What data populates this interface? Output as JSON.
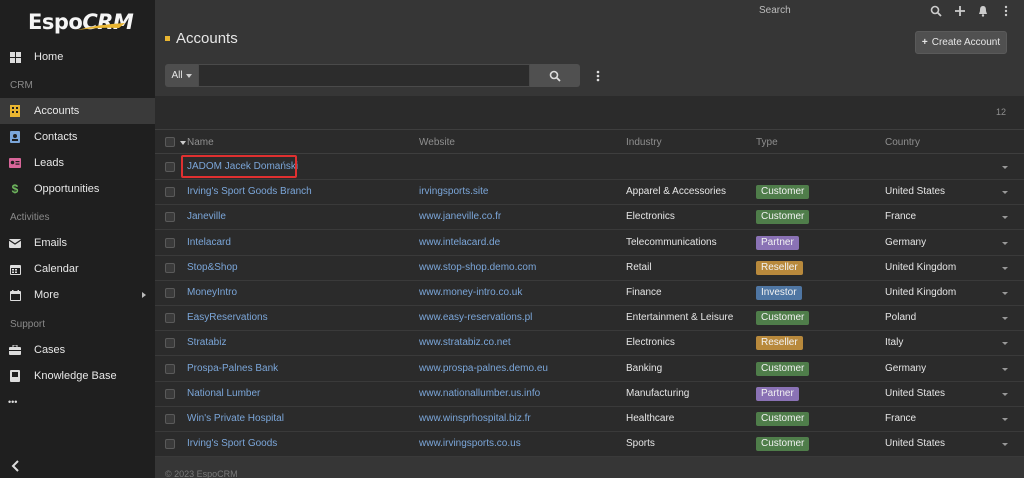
{
  "app": {
    "logo_text": "Espo",
    "logo_text_2": "CRM"
  },
  "sidebar": {
    "items": [
      {
        "label": "Home",
        "icon": "home-icon"
      },
      {
        "label": "Accounts",
        "icon": "building-icon",
        "active": true
      },
      {
        "label": "Contacts",
        "icon": "contact-card-icon"
      },
      {
        "label": "Leads",
        "icon": "id-card-icon"
      },
      {
        "label": "Opportunities",
        "icon": "dollar-icon"
      },
      {
        "label": "Emails",
        "icon": "envelope-icon"
      },
      {
        "label": "Calendar",
        "icon": "calendar-icon"
      },
      {
        "label": "More",
        "icon": "calendar-alt-icon"
      },
      {
        "label": "Cases",
        "icon": "briefcase-icon"
      },
      {
        "label": "Knowledge Base",
        "icon": "book-icon"
      }
    ],
    "sections": {
      "crm": "CRM",
      "activities": "Activities",
      "support": "Support"
    },
    "more_dots": "•••"
  },
  "topbar": {
    "search_placeholder": "Search"
  },
  "header": {
    "title": "Accounts",
    "create_label": "Create Account"
  },
  "search": {
    "filter_label": "All",
    "value": ""
  },
  "list": {
    "count": "12",
    "columns": {
      "name": "Name",
      "website": "Website",
      "industry": "Industry",
      "type": "Type",
      "country": "Country"
    },
    "rows": [
      {
        "name": "JADOM Jacek Domański",
        "website": "",
        "industry": "",
        "type": "",
        "country": ""
      },
      {
        "name": "Irving's Sport Goods Branch",
        "website": "irvingsports.site",
        "industry": "Apparel & Accessories",
        "type": "Customer",
        "country": "United States"
      },
      {
        "name": "Janeville",
        "website": "www.janeville.co.fr",
        "industry": "Electronics",
        "type": "Customer",
        "country": "France"
      },
      {
        "name": "Intelacard",
        "website": "www.intelacard.de",
        "industry": "Telecommunications",
        "type": "Partner",
        "country": "Germany"
      },
      {
        "name": "Stop&Shop",
        "website": "www.stop-shop.demo.com",
        "industry": "Retail",
        "type": "Reseller",
        "country": "United Kingdom"
      },
      {
        "name": "MoneyIntro",
        "website": "www.money-intro.co.uk",
        "industry": "Finance",
        "type": "Investor",
        "country": "United Kingdom"
      },
      {
        "name": "EasyReservations",
        "website": "www.easy-reservations.pl",
        "industry": "Entertainment & Leisure",
        "type": "Customer",
        "country": "Poland"
      },
      {
        "name": "Stratabiz",
        "website": "www.stratabiz.co.net",
        "industry": "Electronics",
        "type": "Reseller",
        "country": "Italy"
      },
      {
        "name": "Prospa-Palnes Bank",
        "website": "www.prospa-palnes.demo.eu",
        "industry": "Banking",
        "type": "Customer",
        "country": "Germany"
      },
      {
        "name": "National Lumber",
        "website": "www.nationallumber.us.info",
        "industry": "Manufacturing",
        "type": "Partner",
        "country": "United States"
      },
      {
        "name": "Win's Private Hospital",
        "website": "www.winsprhospital.biz.fr",
        "industry": "Healthcare",
        "type": "Customer",
        "country": "France"
      },
      {
        "name": "Irving's Sport Goods",
        "website": "www.irvingsports.co.us",
        "industry": "Sports",
        "type": "Customer",
        "country": "United States"
      }
    ]
  },
  "type_colors": {
    "Customer": "#4f7d4a",
    "Partner": "#8a72b5",
    "Reseller": "#b8893c",
    "Investor": "#4f76a3"
  },
  "footer": {
    "text": "© 2023 EspoCRM"
  }
}
